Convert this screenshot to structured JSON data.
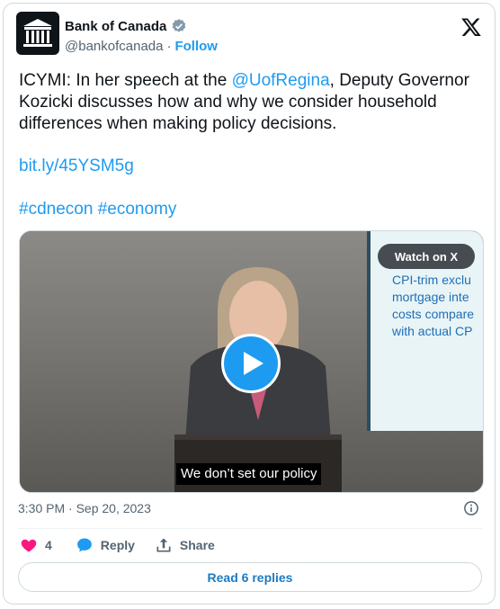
{
  "author": {
    "name": "Bank of Canada",
    "handle": "@bankofcanada",
    "separator": "·",
    "follow_label": "Follow"
  },
  "tweet": {
    "text_prefix": "ICYMI: In her speech at the ",
    "mention": "@UofRegina",
    "text_suffix": ", Deputy Governor Kozicki discusses how and why we consider household differences when making policy decisions.",
    "link": "bit.ly/45YSM5g",
    "hashtag_1": "#cdnecon",
    "hashtag_2": "#economy"
  },
  "media": {
    "watch_label": "Watch on X",
    "caption": "We don’t set our policy",
    "slide_lines": [
      "CPI-trim exclu",
      "mortgage inte",
      "costs compare",
      "with actual CP"
    ]
  },
  "meta": {
    "timestamp": "3:30 PM · Sep 20, 2023"
  },
  "actions": {
    "like_count": "4",
    "reply_label": "Reply",
    "share_label": "Share",
    "read_replies_label": "Read 6 replies"
  },
  "colors": {
    "accent": "#1d9bf0",
    "like": "#f91880",
    "text": "#0f1419",
    "muted": "#536471"
  }
}
